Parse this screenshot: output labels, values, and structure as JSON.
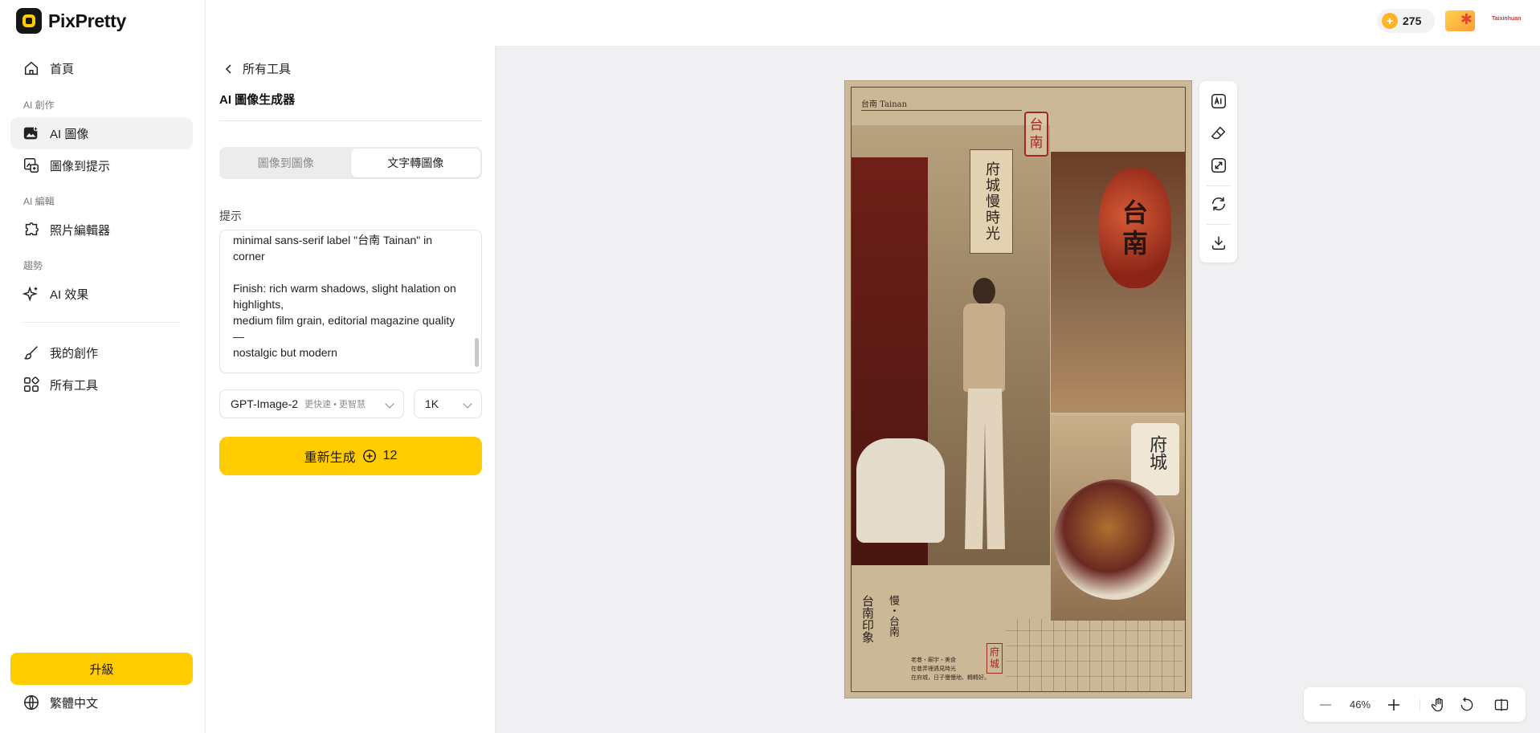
{
  "app": {
    "name": "PixPretty"
  },
  "sidebar": {
    "home": "首頁",
    "section_ai_create": "AI 創作",
    "ai_image": "AI 圖像",
    "image_to_prompt": "圖像到提示",
    "section_ai_edit": "AI 編輯",
    "photo_editor": "照片編輯器",
    "section_trends": "趨勢",
    "ai_effects": "AI 效果",
    "my_creations": "我的創作",
    "all_tools": "所有工具",
    "upgrade": "升級",
    "language": "繁體中文"
  },
  "header": {
    "credits": "275",
    "brand_small": "Taixinhuan"
  },
  "panel": {
    "back": "所有工具",
    "title": "AI 圖像生成器",
    "tabs": [
      {
        "label": "圖像到圖像",
        "active": false
      },
      {
        "label": "文字轉圖像",
        "active": true
      }
    ],
    "prompt_label": "提示",
    "prompt_text": "minimal sans-serif label \"台南 Tainan\" in corner\n\nFinish: rich warm shadows, slight halation on highlights,\nmedium film grain, editorial magazine quality —\nnostalgic but modern",
    "model": {
      "name": "GPT-Image-2",
      "sub": "更快速 • 更智慧"
    },
    "resolution": "1K",
    "generate": {
      "label": "重新生成",
      "cost": "12"
    }
  },
  "poster": {
    "caption": "台南 Tainan",
    "wall_sign": "府城慢時光",
    "stamp_chars": [
      "台",
      "南"
    ],
    "lantern_chars": [
      "台",
      "南"
    ],
    "cup_text": "府城",
    "foot_title": "台南印象",
    "foot_sub": "慢・台南",
    "foot_small": "老巷・廟宇・美食\n在巷弄裡遇見時光\n在府城，日子慢慢地、轉轉好。",
    "stamp_small_chars": [
      "府",
      "城"
    ]
  },
  "canvas": {
    "zoom": "46%"
  },
  "colors": {
    "accent": "#ffcc00",
    "coin": "#ffb428"
  }
}
